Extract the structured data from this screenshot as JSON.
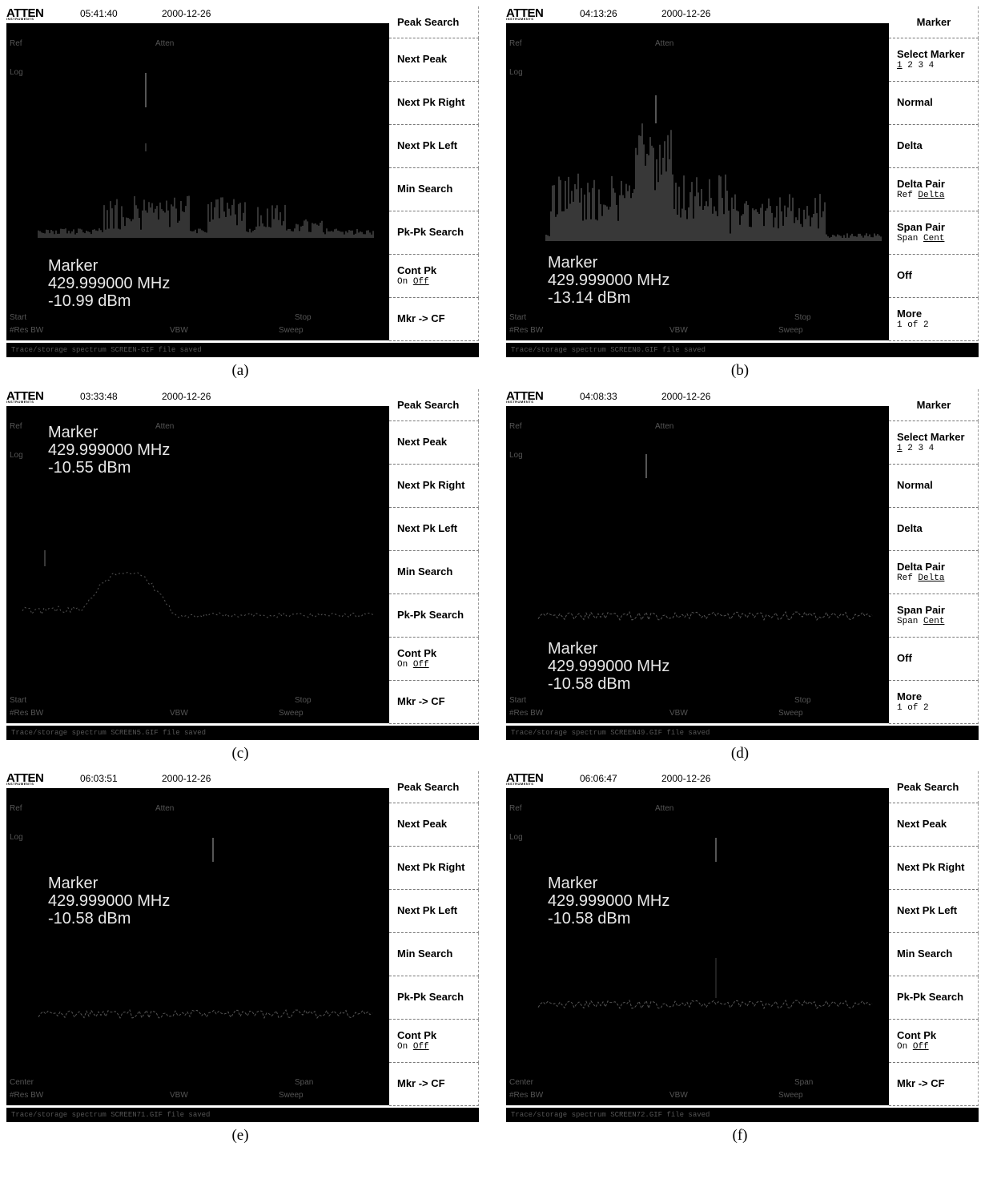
{
  "figure": {
    "panels": [
      {
        "id": "a",
        "caption": "(a)",
        "logo": "ATTEN",
        "logo_sub": "INSTRUMENTS",
        "time": "05:41:40",
        "date": "2000-12-26",
        "labels": {
          "ref": "Ref",
          "atten": "Atten",
          "scale": "Log",
          "left_bottom": "Start",
          "right_bottom": "Stop",
          "res_bw": "#Res BW",
          "vbw": "VBW",
          "sweep": "Sweep"
        },
        "marker": {
          "title": "Marker",
          "frequency": "429.999000 MHz",
          "level": "-10.99 dBm"
        },
        "status": "Trace/storage spectrum SCREEN-GIF file saved",
        "menu": "peak",
        "trace": "broadband_a"
      },
      {
        "id": "b",
        "caption": "(b)",
        "logo": "ATTEN",
        "logo_sub": "INSTRUMENTS",
        "time": "04:13:26",
        "date": "2000-12-26",
        "labels": {
          "ref": "Ref",
          "atten": "Atten",
          "scale": "Log",
          "left_bottom": "Start",
          "right_bottom": "Stop",
          "res_bw": "#Res BW",
          "vbw": "VBW",
          "sweep": "Sweep"
        },
        "marker": {
          "title": "Marker",
          "frequency": "429.999000 MHz",
          "level": "-13.14 dBm"
        },
        "status": "Trace/storage spectrum SCREEN0.GIF file saved",
        "menu": "marker",
        "trace": "broadband_b"
      },
      {
        "id": "c",
        "caption": "(c)",
        "logo": "ATTEN",
        "logo_sub": "INSTRUMENTS",
        "time": "03:33:48",
        "date": "2000-12-26",
        "labels": {
          "ref": "Ref",
          "atten": "Atten",
          "scale": "Log",
          "left_bottom": "Start",
          "right_bottom": "Stop",
          "res_bw": "#Res BW",
          "vbw": "VBW",
          "sweep": "Sweep"
        },
        "marker": {
          "title": "Marker",
          "frequency": "429.999000 MHz",
          "level": "-10.55 dBm"
        },
        "status": "Trace/storage spectrum SCREEN5.GIF file saved",
        "menu": "peak",
        "trace": "hump_c"
      },
      {
        "id": "d",
        "caption": "(d)",
        "logo": "ATTEN",
        "logo_sub": "INSTRUMENTS",
        "time": "04:08:33",
        "date": "2000-12-26",
        "labels": {
          "ref": "Ref",
          "atten": "Atten",
          "scale": "Log",
          "left_bottom": "Start",
          "right_bottom": "Stop",
          "res_bw": "#Res BW",
          "vbw": "VBW",
          "sweep": "Sweep"
        },
        "marker": {
          "title": "Marker",
          "frequency": "429.999000 MHz",
          "level": "-10.58 dBm"
        },
        "status": "Trace/storage spectrum SCREEN49.GIF file saved",
        "menu": "marker",
        "trace": "spike_d"
      },
      {
        "id": "e",
        "caption": "(e)",
        "logo": "ATTEN",
        "logo_sub": "INSTRUMENTS",
        "time": "06:03:51",
        "date": "2000-12-26",
        "labels": {
          "ref": "Ref",
          "atten": "Atten",
          "scale": "Log",
          "left_bottom": "Center",
          "right_bottom": "Span",
          "res_bw": "#Res BW",
          "vbw": "VBW",
          "sweep": "Sweep"
        },
        "marker": {
          "title": "Marker",
          "frequency": "429.999000 MHz",
          "level": "-10.58 dBm"
        },
        "status": "Trace/storage spectrum SCREEN71.GIF file saved",
        "menu": "peak",
        "trace": "spike_e"
      },
      {
        "id": "f",
        "caption": "(f)",
        "logo": "ATTEN",
        "logo_sub": "INSTRUMENTS",
        "time": "06:06:47",
        "date": "2000-12-26",
        "labels": {
          "ref": "Ref",
          "atten": "Atten",
          "scale": "Log",
          "left_bottom": "Center",
          "right_bottom": "Span",
          "res_bw": "#Res BW",
          "vbw": "VBW",
          "sweep": "Sweep"
        },
        "marker": {
          "title": "Marker",
          "frequency": "429.999000 MHz",
          "level": "-10.58 dBm"
        },
        "status": "Trace/storage spectrum SCREEN72.GIF file saved",
        "menu": "peak",
        "trace": "spike_f"
      }
    ]
  },
  "menus": {
    "peak": [
      {
        "title": "Peak Search"
      },
      {
        "title": "Next Peak"
      },
      {
        "title": "Next Pk Right"
      },
      {
        "title": "Next Pk Left"
      },
      {
        "title": "Min Search"
      },
      {
        "title": "Pk-Pk Search"
      },
      {
        "title": "Cont Pk",
        "options": [
          "On",
          "Off"
        ],
        "selected": "Off"
      },
      {
        "title": "Mkr -> CF"
      }
    ],
    "marker": [
      {
        "title": "Marker"
      },
      {
        "title": "Select Marker",
        "options": [
          "1",
          "2",
          "3",
          "4"
        ],
        "selected": "1"
      },
      {
        "title": "Normal"
      },
      {
        "title": "Delta"
      },
      {
        "title": "Delta Pair",
        "options": [
          "Ref",
          "Delta"
        ],
        "selected": "Delta"
      },
      {
        "title": "Span Pair",
        "options": [
          "Span",
          "Cent"
        ],
        "selected": "Cent"
      },
      {
        "title": "Off"
      },
      {
        "title": "More",
        "sub": "1 of 2"
      }
    ]
  },
  "colors": {
    "screen_bg": "#000000",
    "trace": "#bdbdbd",
    "marker_text": "#e8e8e8",
    "softkey_bg": "#ffffff"
  }
}
